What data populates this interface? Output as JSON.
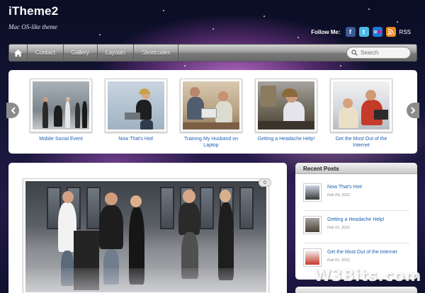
{
  "site": {
    "title": "iTheme2",
    "tagline": "Mac OS-like theme"
  },
  "follow": {
    "label": "Follow Me:",
    "icons": [
      "facebook-icon",
      "twitter-icon",
      "flickr-icon",
      "rss-icon"
    ],
    "rss_label": "RSS"
  },
  "nav": {
    "items": [
      "Contact",
      "Gallery",
      "Layouts",
      "Shortcodes"
    ],
    "search_placeholder": "Search"
  },
  "carousel": {
    "items": [
      {
        "caption": "Mobile Social Event"
      },
      {
        "caption": "Now That's Hot!"
      },
      {
        "caption": "Training My Husband on Laptop"
      },
      {
        "caption": "Getting a Headache Help!"
      },
      {
        "caption": "Get the Most Out of the Internet"
      }
    ]
  },
  "post": {
    "comment_count": "0"
  },
  "sidebar": {
    "heading": "Recent Posts",
    "posts": [
      {
        "title": "Now That's Hot!",
        "date": "Feb 04, 2011"
      },
      {
        "title": "Getting a Headache Help!",
        "date": "Feb 01, 2011"
      },
      {
        "title": "Get the Most Out of the Internet",
        "date": "Feb 01, 2011"
      }
    ]
  },
  "watermark": "W3Bits.com",
  "colors": {
    "link": "#1f5fb0",
    "nav_gradient_top": "#d4d4d4",
    "nav_gradient_bottom": "#6a6a6a",
    "facebook": "#3b5998",
    "twitter": "#4fb8e8",
    "rss": "#f08a24"
  }
}
